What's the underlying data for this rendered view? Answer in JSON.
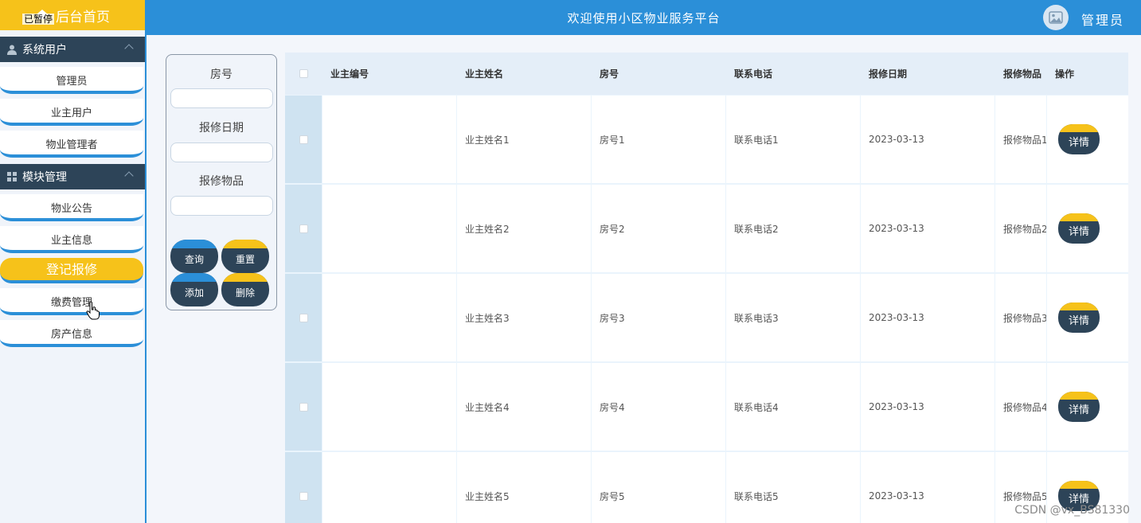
{
  "sidebar": {
    "logo_text": "后台首页",
    "paused_tag": "已暂停",
    "groups": [
      {
        "label": "系统用户",
        "items": [
          "管理员",
          "业主用户",
          "物业管理者"
        ]
      },
      {
        "label": "模块管理",
        "items": [
          "物业公告",
          "业主信息",
          "登记报修",
          "缴费管理",
          "房产信息"
        ]
      }
    ],
    "active_item": "登记报修"
  },
  "header": {
    "title": "欢迎使用小区物业服务平台",
    "user_name": "管理员"
  },
  "search": {
    "fields": [
      {
        "label": "房号",
        "value": ""
      },
      {
        "label": "报修日期",
        "value": ""
      },
      {
        "label": "报修物品",
        "value": ""
      }
    ],
    "buttons": {
      "query": "查询",
      "reset": "重置",
      "add": "添加",
      "delete": "删除"
    }
  },
  "table": {
    "columns": [
      "业主编号",
      "业主姓名",
      "房号",
      "联系电话",
      "报修日期",
      "报修物品",
      "操作"
    ],
    "action_label": "详情",
    "rows": [
      {
        "owner_id": "",
        "owner_name": "业主姓名1",
        "room": "房号1",
        "phone": "联系电话1",
        "date": "2023-03-13",
        "item": "报修物品1"
      },
      {
        "owner_id": "",
        "owner_name": "业主姓名2",
        "room": "房号2",
        "phone": "联系电话2",
        "date": "2023-03-13",
        "item": "报修物品2"
      },
      {
        "owner_id": "",
        "owner_name": "业主姓名3",
        "room": "房号3",
        "phone": "联系电话3",
        "date": "2023-03-13",
        "item": "报修物品3"
      },
      {
        "owner_id": "",
        "owner_name": "业主姓名4",
        "room": "房号4",
        "phone": "联系电话4",
        "date": "2023-03-13",
        "item": "报修物品4"
      },
      {
        "owner_id": "",
        "owner_name": "业主姓名5",
        "room": "房号5",
        "phone": "联系电话5",
        "date": "2023-03-13",
        "item": "报修物品5"
      }
    ]
  },
  "watermark": "CSDN @vx_BS81330",
  "colors": {
    "primary": "#2b8fd8",
    "accent": "#f6c21a",
    "dark": "#2d4458"
  }
}
